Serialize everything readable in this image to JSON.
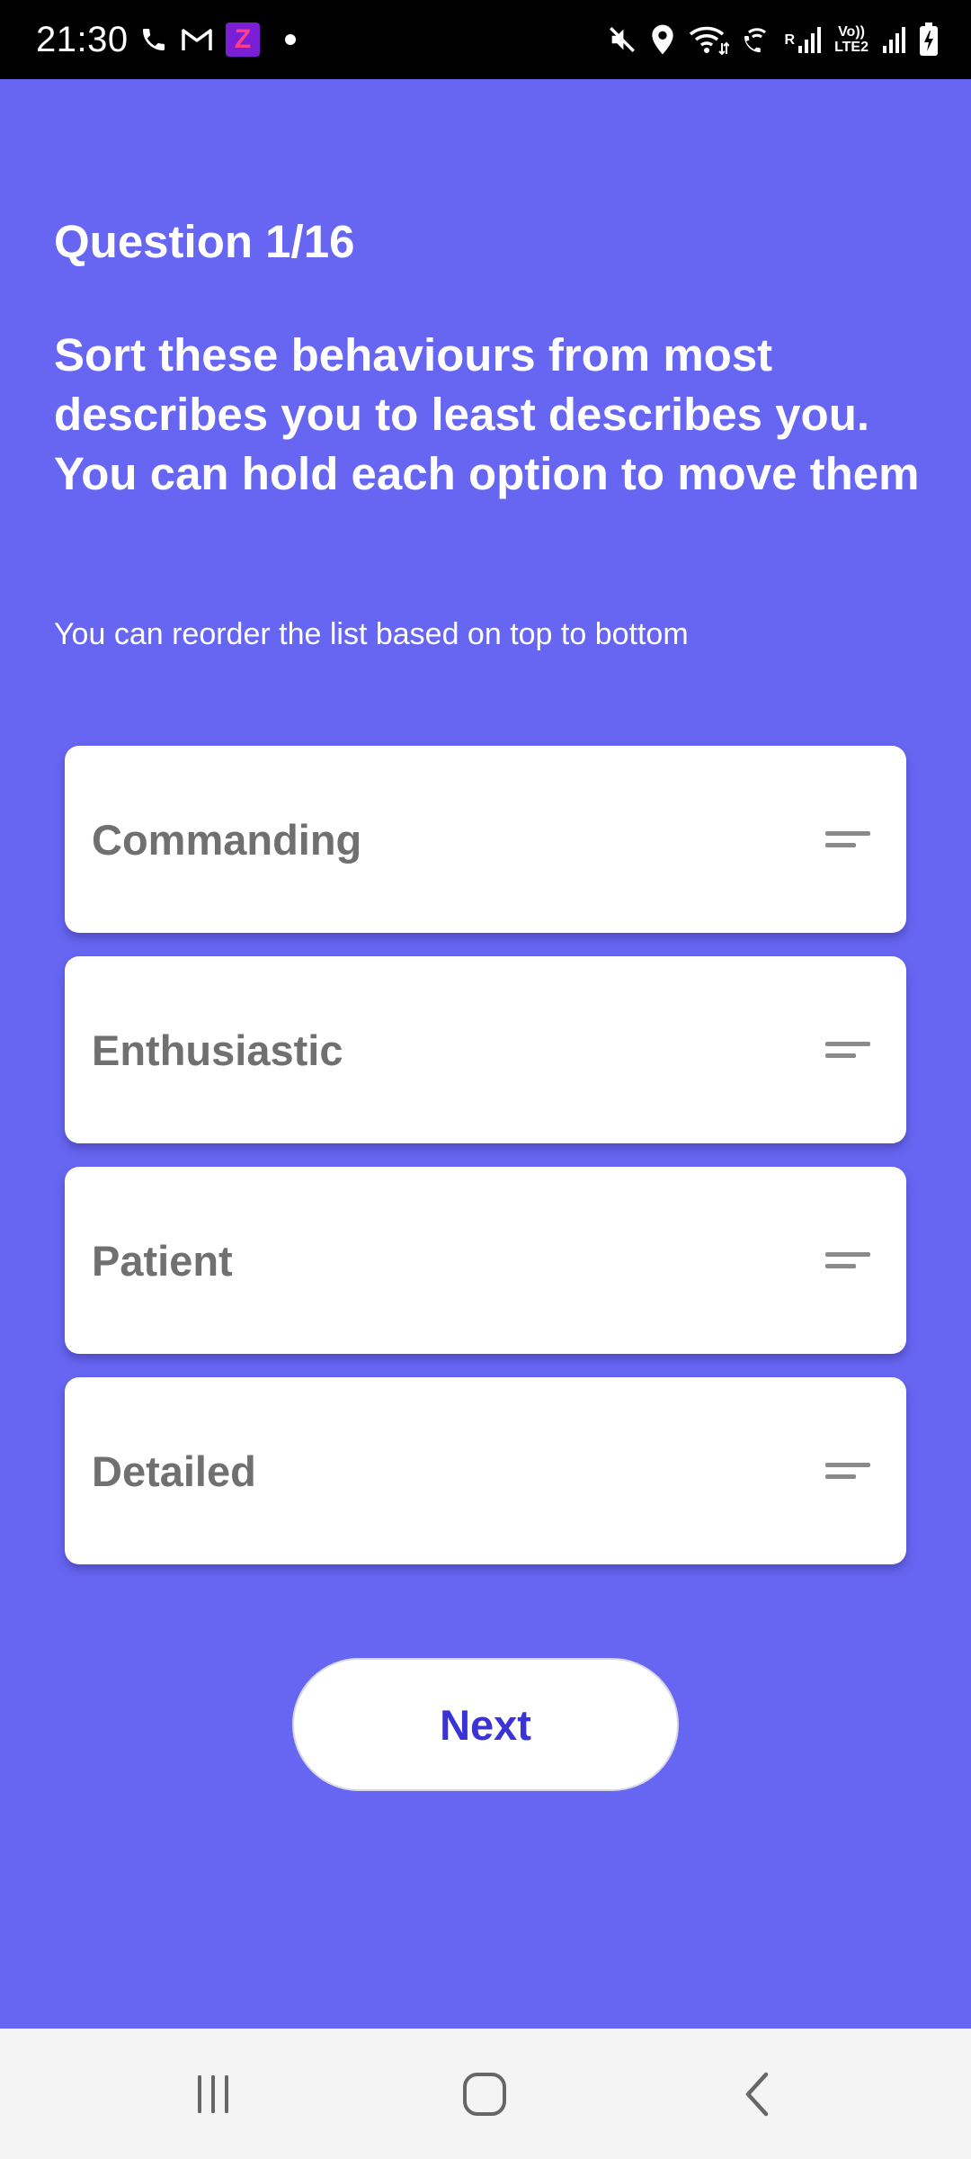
{
  "status_bar": {
    "time": "21:30",
    "app_badge": "Z",
    "sim_labels": {
      "r": "R",
      "volte_top": "Vo))",
      "volte_bottom": "LTE2"
    },
    "icons": [
      "phone-icon",
      "gmail-icon",
      "z-app-icon",
      "notification-dot-icon",
      "mute-icon",
      "location-icon",
      "wifi-icon",
      "wifi-calling-icon",
      "signal-icon",
      "battery-charging-icon"
    ]
  },
  "question": {
    "number": "Question 1/16",
    "text": "Sort these behaviours from most describes you to least describes you. You can hold each option to move them",
    "instruction": "You can reorder the list based on top to bottom"
  },
  "options": [
    {
      "label": "Commanding"
    },
    {
      "label": "Enthusiastic"
    },
    {
      "label": "Patient"
    },
    {
      "label": "Detailed"
    }
  ],
  "next_button": {
    "label": "Next"
  },
  "nav_bar": {
    "icons": [
      "recents-icon",
      "home-icon",
      "back-icon"
    ]
  },
  "colors": {
    "background": "#6666f2",
    "button_text": "#3a34d6",
    "option_text": "#707070"
  }
}
